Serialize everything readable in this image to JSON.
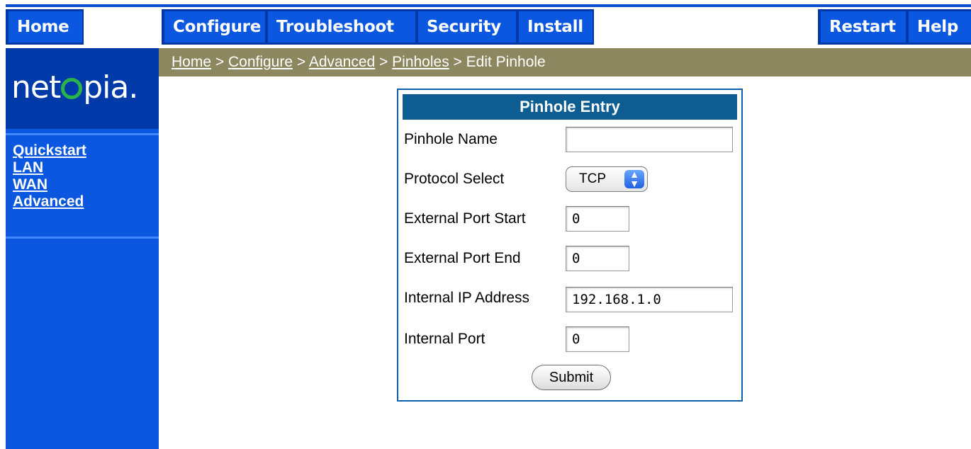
{
  "nav": {
    "home": "Home",
    "configure": "Configure",
    "troubleshoot": "Troubleshoot",
    "security": "Security",
    "install": "Install",
    "restart": "Restart",
    "help": "Help"
  },
  "brand": {
    "logo_text_a": "net",
    "logo_text_b": "pia",
    "logo_dot": "."
  },
  "sidebar": {
    "items": [
      "Quickstart",
      "LAN",
      "WAN",
      "Advanced"
    ]
  },
  "breadcrumb": {
    "home": "Home",
    "configure": "Configure",
    "advanced": "Advanced",
    "pinholes": "Pinholes",
    "current": "Edit Pinhole",
    "sep": " > "
  },
  "form": {
    "title": "Pinhole Entry",
    "pinhole_name_label": "Pinhole Name",
    "pinhole_name_value": "",
    "protocol_label": "Protocol Select",
    "protocol_value": "TCP",
    "ext_port_start_label": "External Port Start",
    "ext_port_start_value": "0",
    "ext_port_end_label": "External Port End",
    "ext_port_end_value": "0",
    "internal_ip_label": "Internal IP Address",
    "internal_ip_value": "192.168.1.0",
    "internal_port_label": "Internal Port",
    "internal_port_value": "0",
    "submit_label": "Submit"
  },
  "colors": {
    "nav_blue": "#0b57e0",
    "logo_bg": "#003aa8",
    "breadcrumb_bg": "#8d8760",
    "panel_header": "#0d5d92",
    "logo_ring": "#29b34a"
  }
}
